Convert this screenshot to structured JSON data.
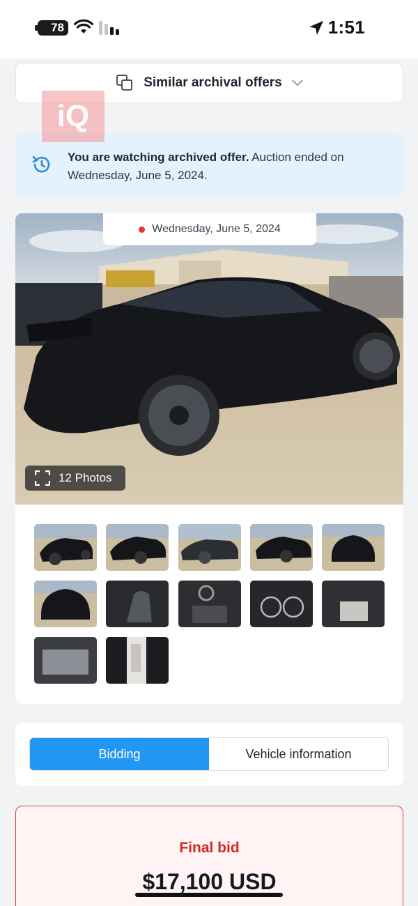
{
  "status_bar": {
    "battery": "78",
    "time": "1:51"
  },
  "similar_offers": {
    "label": "Similar archival offers"
  },
  "watermark": {
    "text": "iQ"
  },
  "notice": {
    "bold": "You are watching archived offer.",
    "text": " Auction ended on Wednesday, June 5, 2024."
  },
  "gallery": {
    "date": "Wednesday, June 5, 2024",
    "photos_label": "12 Photos",
    "thumbnails": [
      "rear-left view",
      "rear view",
      "left side view",
      "left side view",
      "front view",
      "rear view",
      "driver seat",
      "dashboard",
      "instrument cluster",
      "rear seats",
      "engine bay",
      "door label"
    ]
  },
  "tabs": [
    {
      "label": "Bidding",
      "active": true
    },
    {
      "label": "Vehicle information",
      "active": false
    }
  ],
  "final_bid": {
    "label": "Final bid",
    "value": "$17,100 USD"
  },
  "colors": {
    "accent": "#2196f3",
    "alert_red": "#d02a25",
    "notice_bg": "#e3f2fc"
  }
}
